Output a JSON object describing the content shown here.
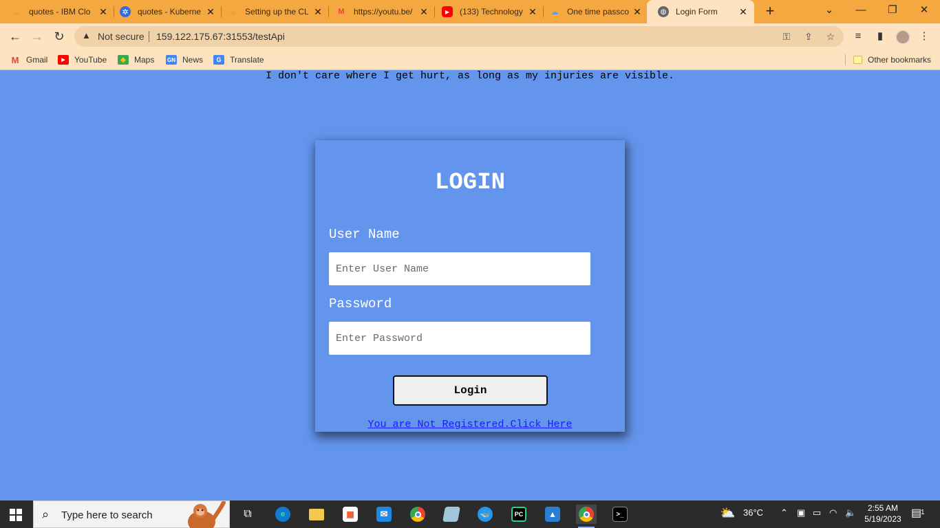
{
  "browser": {
    "tabs": [
      {
        "title": "quotes - IBM Clo",
        "icon": "cloud-icon",
        "color": "#f5a83f"
      },
      {
        "title": "quotes - Kuberne",
        "icon": "kubernetes-icon",
        "color": "#326ce5"
      },
      {
        "title": "Setting up the CL",
        "icon": "cloud-icon",
        "color": "#f5a83f"
      },
      {
        "title": "https://youtu.be/",
        "icon": "gmail-icon",
        "color": "#ea4335"
      },
      {
        "title": "(133) Technology",
        "icon": "youtube-icon",
        "color": "#ff0000"
      },
      {
        "title": "One time passco",
        "icon": "onedrive-icon",
        "color": "#5aa0e0"
      },
      {
        "title": "Login Form",
        "icon": "globe-icon",
        "color": "#555555"
      }
    ],
    "close_glyph": "✕",
    "new_tab_glyph": "+",
    "security_label": "Not secure",
    "url": "159.122.175.67:31553/testApi",
    "bookmarks": [
      {
        "label": "Gmail",
        "icon": "gmail-icon"
      },
      {
        "label": "YouTube",
        "icon": "youtube-icon"
      },
      {
        "label": "Maps",
        "icon": "maps-icon"
      },
      {
        "label": "News",
        "icon": "news-icon"
      },
      {
        "label": "Translate",
        "icon": "translate-icon"
      }
    ],
    "other_bookmarks": "Other bookmarks"
  },
  "page": {
    "quote": "I don't care where I get hurt, as long as my injuries are visible.",
    "form": {
      "title": "LOGIN",
      "username_label": "User Name",
      "username_placeholder": "Enter User Name",
      "username_value": "",
      "password_label": "Password",
      "password_placeholder": "Enter Password",
      "password_value": "",
      "submit_label": "Login",
      "register_link": "You are Not Registered.Click Here"
    },
    "background_color": "#6495ed"
  },
  "taskbar": {
    "search_placeholder": "Type here to search",
    "weather": "36°C",
    "time": "2:55 AM",
    "date": "5/19/2023",
    "notification_count": "1"
  }
}
